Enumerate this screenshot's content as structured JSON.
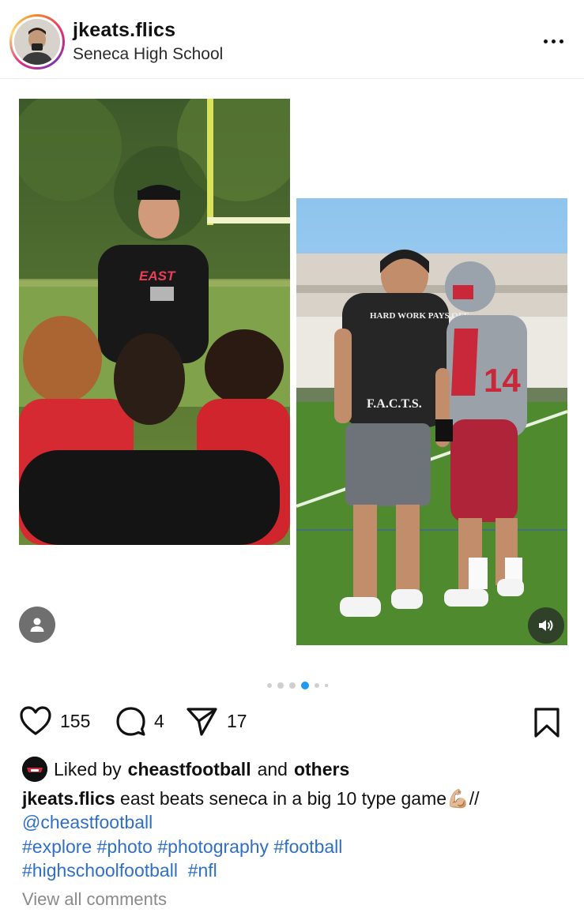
{
  "post": {
    "username": "jkeats.flics",
    "location": "Seneca High School"
  },
  "media": {
    "carousel_dots": 6,
    "active_index": 3,
    "photo1_description_icon": "coach-on-field-photo",
    "photo2_description_icon": "coach-and-player-photo",
    "shirt_text_front": "EAST",
    "shirt_text_back_top": "HARD WORK PAYS OFF",
    "shirt_text_back_bottom": "F.A.C.T.S.",
    "jersey_number": "14"
  },
  "actions": {
    "likes": "155",
    "comments": "4",
    "shares": "17"
  },
  "liked_by": {
    "prefix": "Liked by",
    "user": "cheastfootball",
    "conjunction": "and",
    "others": "others"
  },
  "caption": {
    "username": "jkeats.flics",
    "text": "east beats seneca in a big 10 type game",
    "emoji": "💪🏼",
    "suffix": "//",
    "mention": "@cheastfootball",
    "hashtags_line1": "#explore #photo #photography #football",
    "hashtags_line2": "#highschoolfootball  #nfl"
  },
  "view_comments": "View all comments",
  "colors": {
    "link": "#2f6fc6",
    "active_dot": "#1d9bf0",
    "jersey_red": "#c8283a"
  }
}
